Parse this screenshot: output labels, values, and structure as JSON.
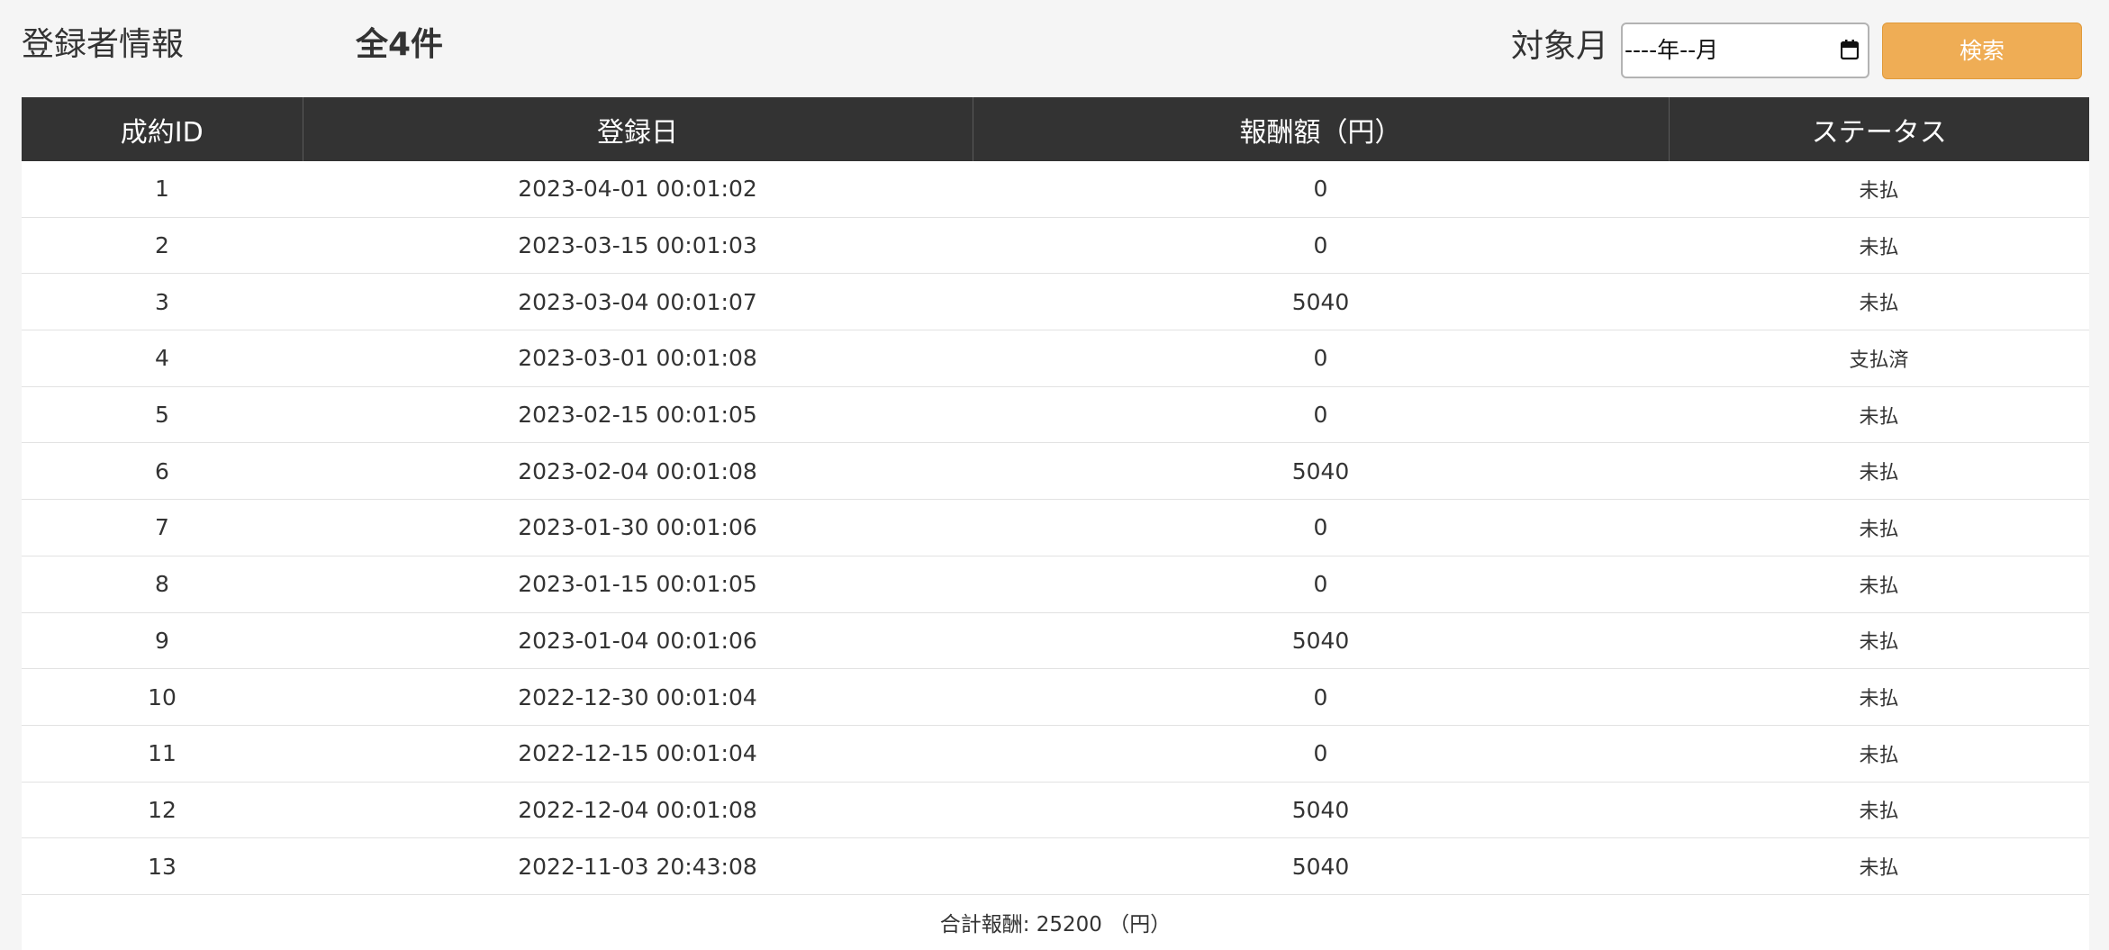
{
  "header": {
    "title": "登録者情報",
    "count": "全4件",
    "month_label": "対象月",
    "month_input_value": "----年--月",
    "search_button": "検索"
  },
  "table": {
    "columns": [
      "成約ID",
      "登録日",
      "報酬額（円）",
      "ステータス"
    ],
    "rows": [
      {
        "id": "1",
        "date": "2023-04-01 00:01:02",
        "amount": "0",
        "status": "未払"
      },
      {
        "id": "2",
        "date": "2023-03-15 00:01:03",
        "amount": "0",
        "status": "未払"
      },
      {
        "id": "3",
        "date": "2023-03-04 00:01:07",
        "amount": "5040",
        "status": "未払"
      },
      {
        "id": "4",
        "date": "2023-03-01 00:01:08",
        "amount": "0",
        "status": "支払済"
      },
      {
        "id": "5",
        "date": "2023-02-15 00:01:05",
        "amount": "0",
        "status": "未払"
      },
      {
        "id": "6",
        "date": "2023-02-04 00:01:08",
        "amount": "5040",
        "status": "未払"
      },
      {
        "id": "7",
        "date": "2023-01-30 00:01:06",
        "amount": "0",
        "status": "未払"
      },
      {
        "id": "8",
        "date": "2023-01-15 00:01:05",
        "amount": "0",
        "status": "未払"
      },
      {
        "id": "9",
        "date": "2023-01-04 00:01:06",
        "amount": "5040",
        "status": "未払"
      },
      {
        "id": "10",
        "date": "2022-12-30 00:01:04",
        "amount": "0",
        "status": "未払"
      },
      {
        "id": "11",
        "date": "2022-12-15 00:01:04",
        "amount": "0",
        "status": "未払"
      },
      {
        "id": "12",
        "date": "2022-12-04 00:01:08",
        "amount": "5040",
        "status": "未払"
      },
      {
        "id": "13",
        "date": "2022-11-03 20:43:08",
        "amount": "5040",
        "status": "未払"
      }
    ],
    "total": "合計報酬: 25200 （円）"
  },
  "icons": {
    "calendar": "calendar-icon"
  },
  "colors": {
    "page_background": "#f5f5f5",
    "table_header": "#333333",
    "search_button": "#efad55",
    "row_border": "#e2e2e2"
  }
}
